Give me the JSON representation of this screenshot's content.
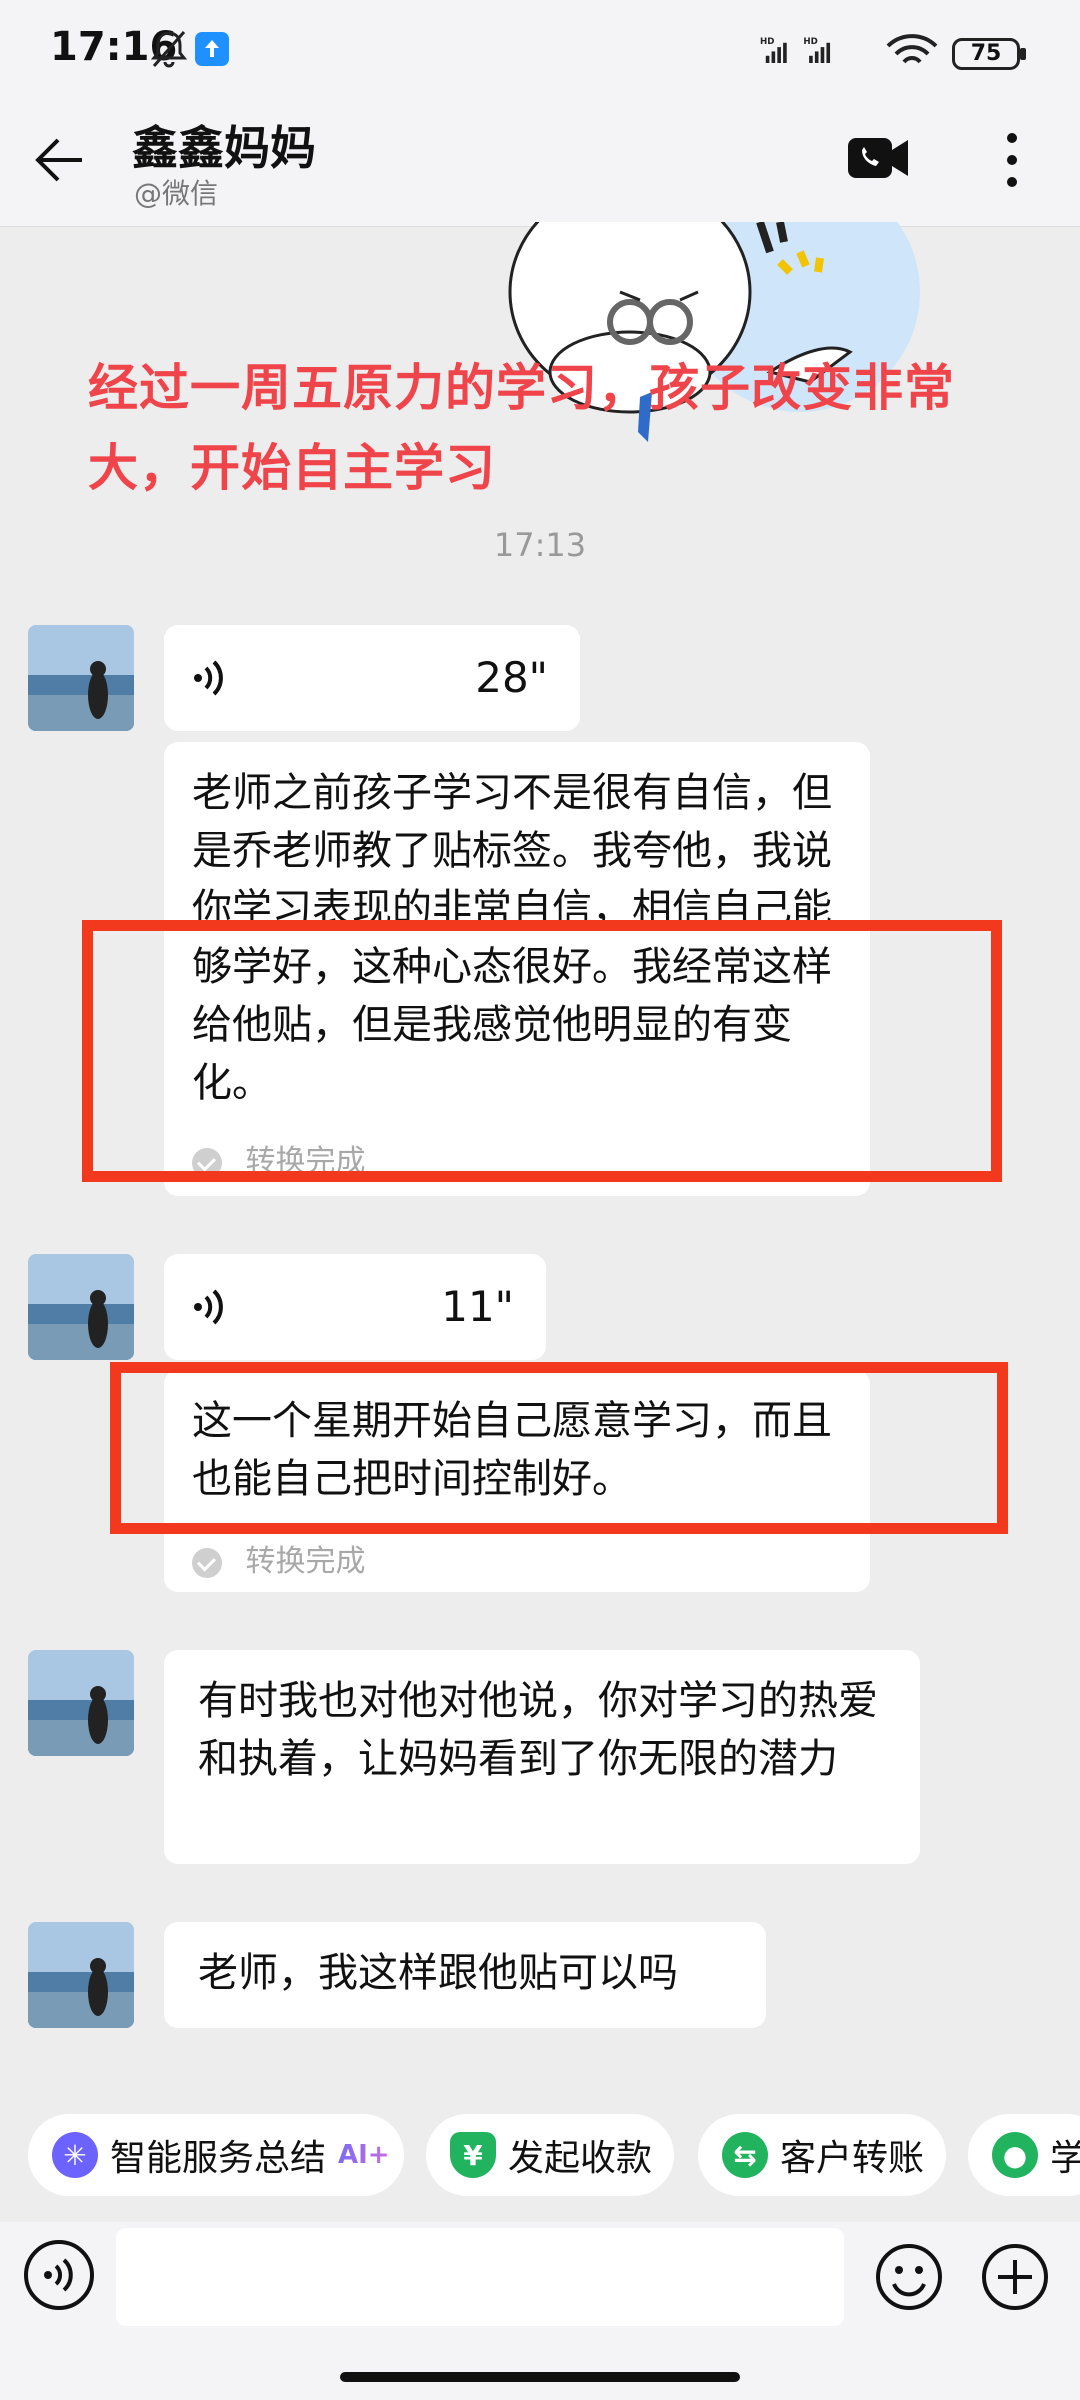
{
  "status_bar": {
    "time": "17:16",
    "battery": "75"
  },
  "header": {
    "title": "鑫鑫妈妈",
    "subtitle": "@微信"
  },
  "overlay_text": "经过一周五原力的学习，孩子改变非常大，开始自主学习",
  "timestamp": "17:13",
  "messages": [
    {
      "type": "voice",
      "duration": "28\"",
      "transcript": "老师之前孩子学习不是很有自信，但是乔老师教了贴标签。我夸他，我说你学习表现的非常自信，相信自己能够学好，这种心态很好。我经常这样给他贴，但是我感觉他明显的有变化。",
      "status": "转换完成"
    },
    {
      "type": "voice",
      "duration": "11\"",
      "transcript": "这一个星期开始自己愿意学习，而且也能自己把时间控制好。",
      "status": "转换完成"
    },
    {
      "type": "text",
      "text": "有时我也对他对他说，你对学习的热爱和执着，让妈妈看到了你无限的潜力"
    },
    {
      "type": "text",
      "text": "老师，我这样跟他贴可以吗"
    }
  ],
  "toolbar": {
    "chips": [
      {
        "label": "智能服务总结",
        "tag": "AI+",
        "icon": "sparkle-icon",
        "color": "#6C63FF"
      },
      {
        "label": "发起收款",
        "icon": "yuan-icon",
        "color": "#22B35E"
      },
      {
        "label": "客户转账",
        "icon": "transfer-icon",
        "color": "#22B35E"
      },
      {
        "label": "学",
        "icon": "person-icon",
        "color": "#22B35E"
      }
    ]
  },
  "input": {
    "value": "",
    "placeholder": ""
  },
  "colors": {
    "accent_red": "#F0444B",
    "highlight_box": "#F2391E",
    "chat_bg": "#EDEDED",
    "bubble_bg": "#FFFFFF"
  }
}
